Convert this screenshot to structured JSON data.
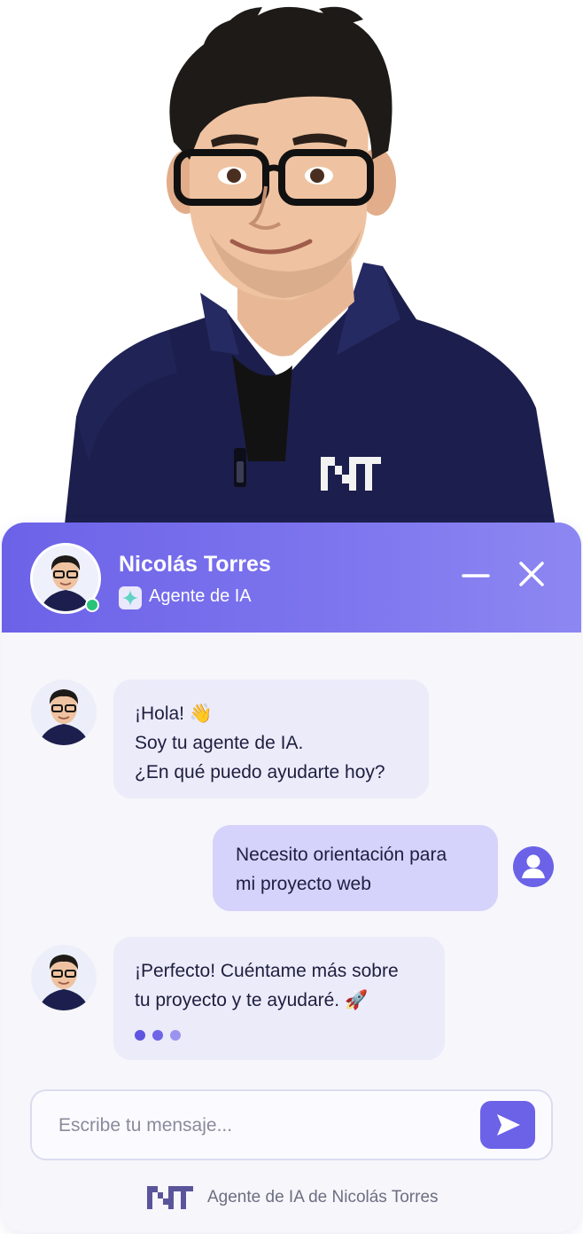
{
  "header": {
    "name": "Nicolás Torres",
    "subtitle": "Agente de IA",
    "status": "online"
  },
  "messages": [
    {
      "sender": "bot",
      "lines": [
        "¡Hola! 👋",
        "Soy tu agente de IA.",
        "¿En qué puedo ayudarte hoy?"
      ]
    },
    {
      "sender": "user",
      "lines": [
        "Necesito orientación para",
        "mi proyecto web"
      ]
    },
    {
      "sender": "bot",
      "lines": [
        "¡Perfecto! Cuéntame más sobre",
        "tu proyecto y te ayudaré. 🚀"
      ],
      "typing": true
    }
  ],
  "input": {
    "placeholder": "Escribe tu mensaje...",
    "value": ""
  },
  "footer": {
    "text": "Agente de IA de Nicolás Torres"
  },
  "icons": {
    "minimize": "minimize-icon",
    "close": "close-icon",
    "sparkle": "sparkle-icon",
    "user": "user-icon",
    "send": "send-icon",
    "logo": "nt-logo"
  },
  "colors": {
    "accent": "#6c62e8",
    "header_gradient_end": "#8d87f2",
    "online": "#29c47a",
    "bot_bubble": "#ecebfa",
    "user_bubble": "#d5d2fb",
    "text": "#1d1f3f",
    "jacket": "#1c1f4d"
  }
}
